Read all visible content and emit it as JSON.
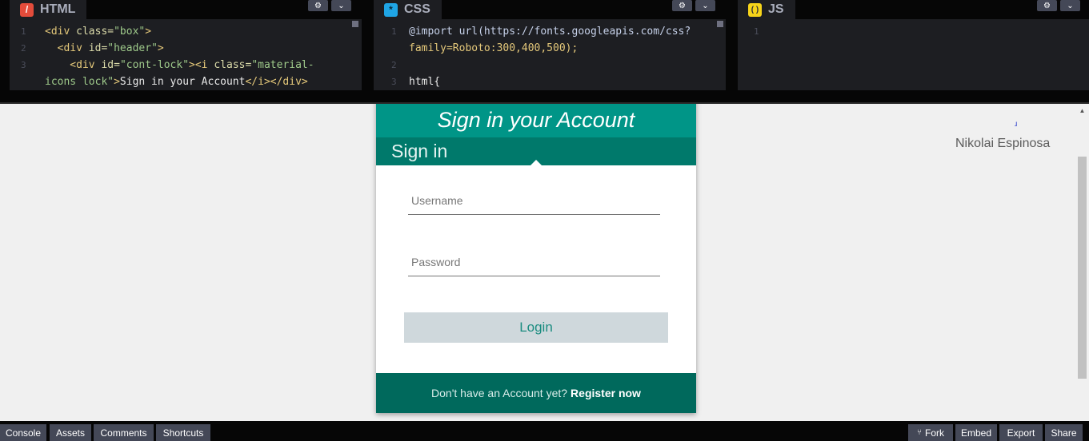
{
  "panels": {
    "html": {
      "label": "HTML",
      "icon": "html-icon"
    },
    "css": {
      "label": "CSS",
      "icon": "css-icon"
    },
    "js": {
      "label": "JS",
      "icon": "js-icon"
    }
  },
  "html_code": {
    "l1n": "1",
    "l1": [
      "<div ",
      "class=",
      "\"box\"",
      ">"
    ],
    "l2n": "2",
    "l2": [
      "  <div ",
      "id=",
      "\"header\"",
      ">"
    ],
    "l3n": "3",
    "l3a": [
      "    <div ",
      "id=",
      "\"cont-lock\"",
      "><i ",
      "class=",
      "\"material-"
    ],
    "l3b": [
      "icons lock\"",
      ">",
      "Sign in your Account",
      "</i></div>"
    ]
  },
  "css_code": {
    "l1n": "1",
    "l1a": "@import url(https://fonts.googleapis.com/css?",
    "l1b": "family=Roboto:300,400,500);",
    "l2n": "2",
    "l3n": "3",
    "l3": "html{"
  },
  "js_code": {
    "l1n": "1"
  },
  "preview": {
    "header_title": "Sign in your Account",
    "signin_label": "Sign in",
    "username_placeholder": "Username",
    "password_placeholder": "Password",
    "login_label": "Login",
    "footer_question": "Don't have an Account yet?",
    "footer_link": "Register now",
    "author_name": "Nikolai Espinosa"
  },
  "bottom_bar": {
    "console": "Console",
    "assets": "Assets",
    "comments": "Comments",
    "shortcuts": "Shortcuts",
    "fork": "Fork",
    "embed": "Embed",
    "export": "Export",
    "share": "Share"
  },
  "colors": {
    "header_teal": "#009587",
    "signin_teal": "#00796b",
    "footer_teal": "#00695c",
    "login_bg": "#cfd8dc"
  }
}
